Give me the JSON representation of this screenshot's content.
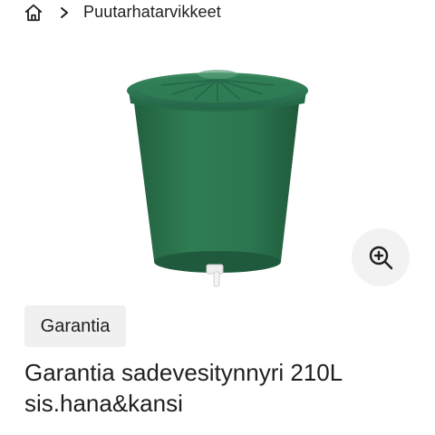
{
  "breadcrumb": {
    "home_icon": "home-icon",
    "separator_icon": "chevron-right-icon",
    "category": "Puutarhatarvikkeet"
  },
  "product": {
    "image_subject": "green-rain-barrel-with-lid-and-tap",
    "brand_badge": "Garantia",
    "title_line1": "Garantia sadevesitynnyri 210L",
    "title_line2": "sis.hana&kansi"
  },
  "zoom": {
    "icon": "zoom-in-icon"
  },
  "colors": {
    "barrel": "#2e7a52",
    "barrel_dark": "#1f5d3d",
    "badge_bg": "#f0f0f0",
    "zoom_bg": "#f2f2f2"
  }
}
